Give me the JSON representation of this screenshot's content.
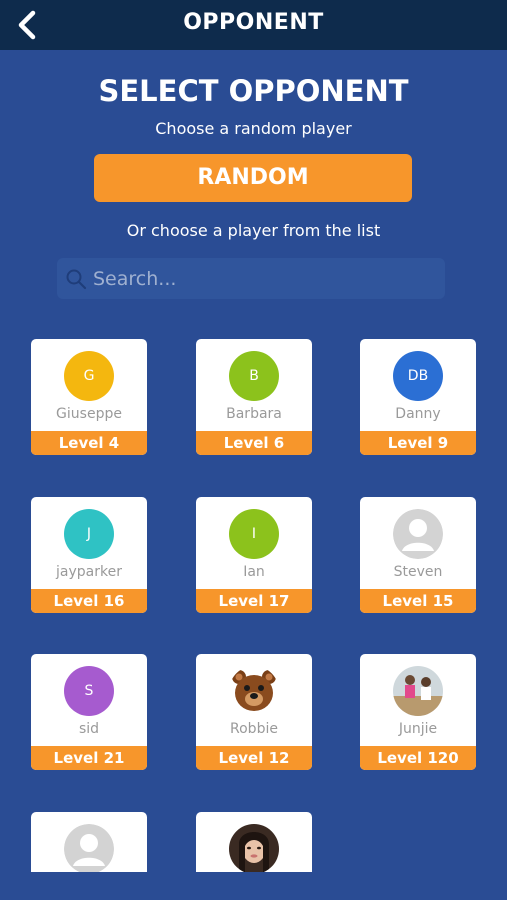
{
  "header": {
    "title": "OPPONENT"
  },
  "main": {
    "title": "SELECT OPPONENT",
    "random_prompt": "Choose a random player",
    "random_label": "RANDOM",
    "list_prompt": "Or choose a player from the list"
  },
  "search": {
    "placeholder": "Search..."
  },
  "colors": {
    "background": "#2a4c94",
    "header": "#0e2b4c",
    "accent": "#f7962b"
  },
  "players": [
    {
      "initials": "G",
      "name": "Giuseppe",
      "level": "Level 4",
      "avatar_color": "#f4b70f",
      "avatar_kind": "initials"
    },
    {
      "initials": "B",
      "name": "Barbara",
      "level": "Level 6",
      "avatar_color": "#8cc21c",
      "avatar_kind": "initials"
    },
    {
      "initials": "DB",
      "name": "Danny",
      "level": "Level 9",
      "avatar_color": "#2b6fd4",
      "avatar_kind": "initials"
    },
    {
      "initials": "J",
      "name": "jayparker",
      "level": "Level 16",
      "avatar_color": "#2fc2c4",
      "avatar_kind": "initials"
    },
    {
      "initials": "I",
      "name": "Ian",
      "level": "Level 17",
      "avatar_color": "#8cc21c",
      "avatar_kind": "initials"
    },
    {
      "initials": "",
      "name": "Steven",
      "level": "Level 15",
      "avatar_color": "#d3d3d3",
      "avatar_kind": "silhouette"
    },
    {
      "initials": "S",
      "name": "sid",
      "level": "Level 21",
      "avatar_color": "#a65bcf",
      "avatar_kind": "initials"
    },
    {
      "initials": "",
      "name": "Robbie",
      "level": "Level 12",
      "avatar_color": "#8a4b1e",
      "avatar_kind": "bear"
    },
    {
      "initials": "",
      "name": "Junjie",
      "level": "Level 120",
      "avatar_color": "#c9a77a",
      "avatar_kind": "photo"
    },
    {
      "initials": "",
      "name": "",
      "level": "",
      "avatar_color": "#d3d3d3",
      "avatar_kind": "silhouette"
    },
    {
      "initials": "",
      "name": "",
      "level": "",
      "avatar_color": "#3a2a22",
      "avatar_kind": "photo-woman"
    }
  ]
}
